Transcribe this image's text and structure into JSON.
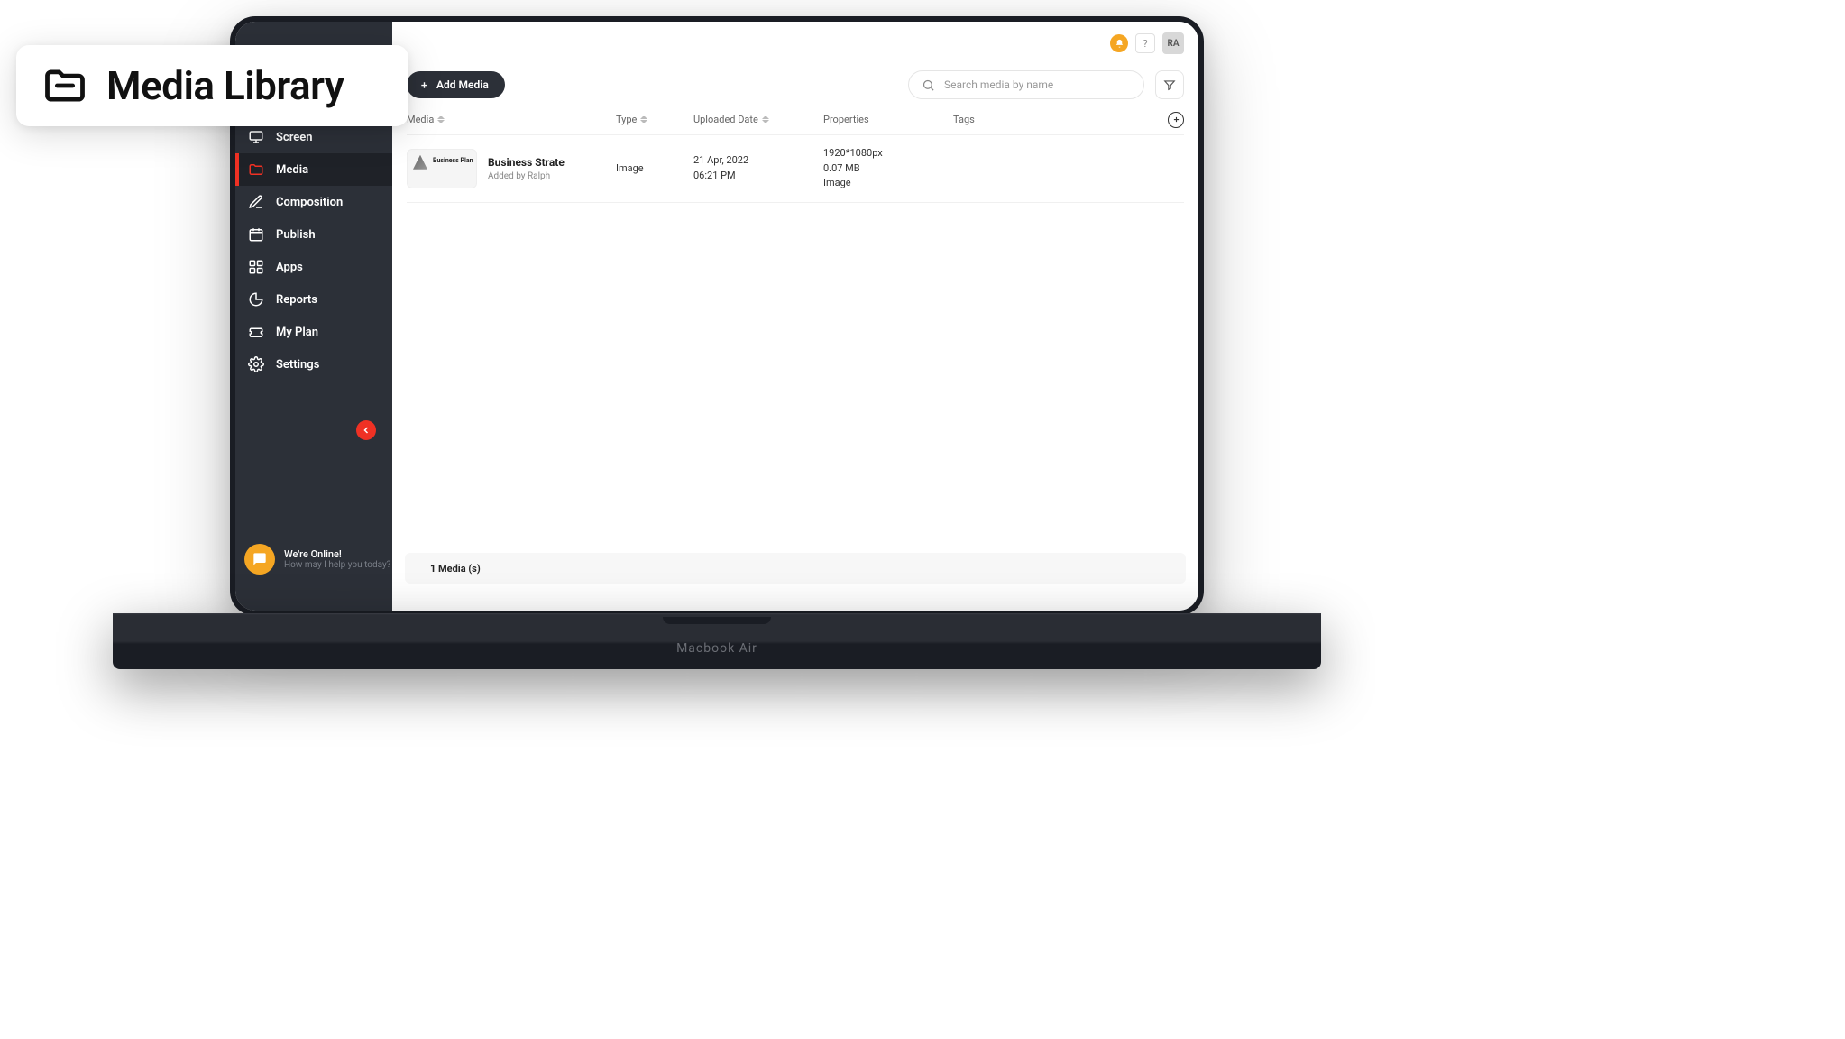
{
  "title_card": {
    "label": "Media Library"
  },
  "laptop_label": "Macbook Air",
  "topbar": {
    "help": "?",
    "avatar": "RA"
  },
  "sidebar": {
    "items": [
      {
        "label": "Screen"
      },
      {
        "label": "Media"
      },
      {
        "label": "Composition"
      },
      {
        "label": "Publish"
      },
      {
        "label": "Apps"
      },
      {
        "label": "Reports"
      },
      {
        "label": "My Plan"
      },
      {
        "label": "Settings"
      }
    ],
    "chat": {
      "line1": "We're Online!",
      "line2": "How may I help you today?"
    }
  },
  "actions": {
    "add_label": "Add Media",
    "search_placeholder": "Search media by name"
  },
  "table": {
    "headers": {
      "media": "Media",
      "type": "Type",
      "uploaded": "Uploaded Date",
      "properties": "Properties",
      "tags": "Tags"
    },
    "rows": [
      {
        "thumb_text": "Business Plan",
        "name": "Business Strate",
        "added_by": "Added by Ralph",
        "type": "Image",
        "date_line1": "21 Apr, 2022",
        "date_line2": "06:21 PM",
        "prop_dim": "1920*1080px",
        "prop_size": "0.07 MB",
        "prop_kind": "Image",
        "tags": ""
      }
    ]
  },
  "footer": {
    "count": "1 Media (s)"
  }
}
